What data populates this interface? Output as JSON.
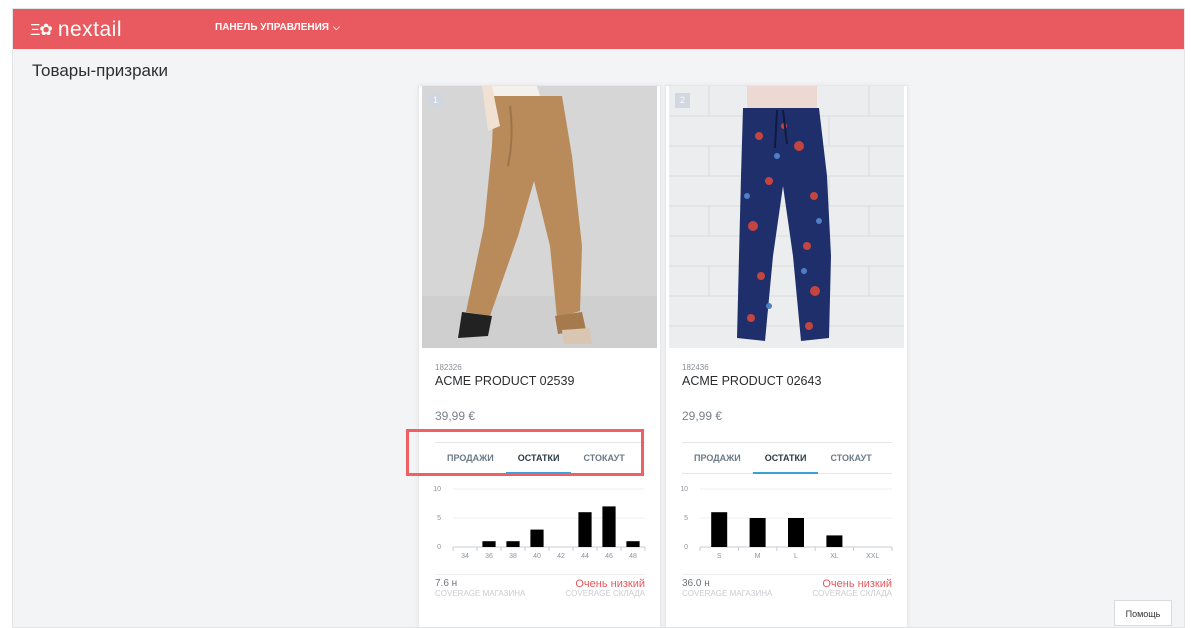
{
  "app": {
    "logo_mark": "Ξ✿",
    "logo_text": "nextail",
    "brand_color": "#e85a5f",
    "accent_color": "#3aa0d8"
  },
  "nav": {
    "dashboard_label": "ПАНЕЛЬ УПРАВЛЕНИЯ",
    "chevron": "⌵"
  },
  "page": {
    "title": "Товары-призраки"
  },
  "products": [
    {
      "rank": "1",
      "sku": "182326",
      "name": "ACME PRODUCT 02539",
      "price": "39,99 €",
      "image": "beige-trousers",
      "tabs": [
        "ПРОДАЖИ",
        "ОСТАТКИ",
        "СТОКАУТ"
      ],
      "active_tab": "ОСТАТКИ",
      "coverage_store": "7.6 н",
      "coverage_status": "Очень низкий",
      "coverage_store_label": "COVERAGE МАГАЗИНА",
      "coverage_wh_label": "COVERAGE СКЛАДА",
      "chart_data": {
        "type": "bar",
        "categories": [
          "34",
          "36",
          "38",
          "40",
          "42",
          "44",
          "46",
          "48"
        ],
        "values": [
          0,
          1,
          1,
          3,
          0,
          6,
          7,
          1
        ],
        "yticks": [
          "0",
          "5",
          "10"
        ],
        "ylim": [
          0,
          10
        ]
      }
    },
    {
      "rank": "2",
      "sku": "182436",
      "name": "ACME PRODUCT 02643",
      "price": "29,99 €",
      "image": "floral-trousers",
      "tabs": [
        "ПРОДАЖИ",
        "ОСТАТКИ",
        "СТОКАУТ"
      ],
      "active_tab": "ОСТАТКИ",
      "coverage_store": "36.0 н",
      "coverage_status": "Очень низкий",
      "coverage_store_label": "COVERAGE МАГАЗИНА",
      "coverage_wh_label": "COVERAGE СКЛАДА",
      "chart_data": {
        "type": "bar",
        "categories": [
          "S",
          "M",
          "L",
          "XL",
          "XXL"
        ],
        "values": [
          6,
          5,
          5,
          2,
          0
        ],
        "yticks": [
          "0",
          "5",
          "10"
        ],
        "ylim": [
          0,
          10
        ]
      }
    }
  ],
  "help": {
    "label": "Помощь"
  }
}
